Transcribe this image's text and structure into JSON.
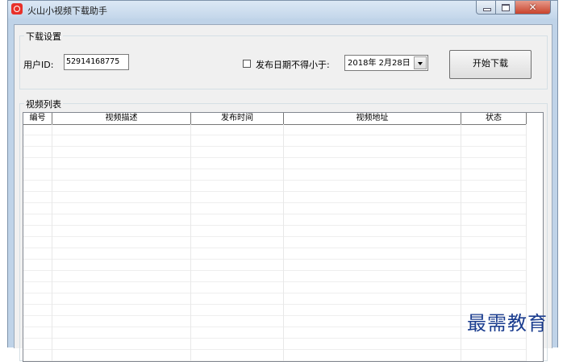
{
  "window": {
    "title": "火山小视频下载助手",
    "close_glyph": "✕"
  },
  "download_settings": {
    "group_label": "下载设置",
    "user_id_label": "用户ID:",
    "user_id_value": "52914168775",
    "date_filter_label": "发布日期不得小于:",
    "date_filter_checked": false,
    "date_value": "2018年 2月28日",
    "start_button_label": "开始下载"
  },
  "video_list": {
    "group_label": "视频列表",
    "columns": [
      "编号",
      "视频描述",
      "发布时间",
      "视频地址",
      "状态"
    ],
    "rows": []
  },
  "watermark": "最需教育",
  "colors": {
    "close_button": "#c9432c",
    "app_icon": "#e8312a",
    "watermark": "#1b3d8f"
  }
}
